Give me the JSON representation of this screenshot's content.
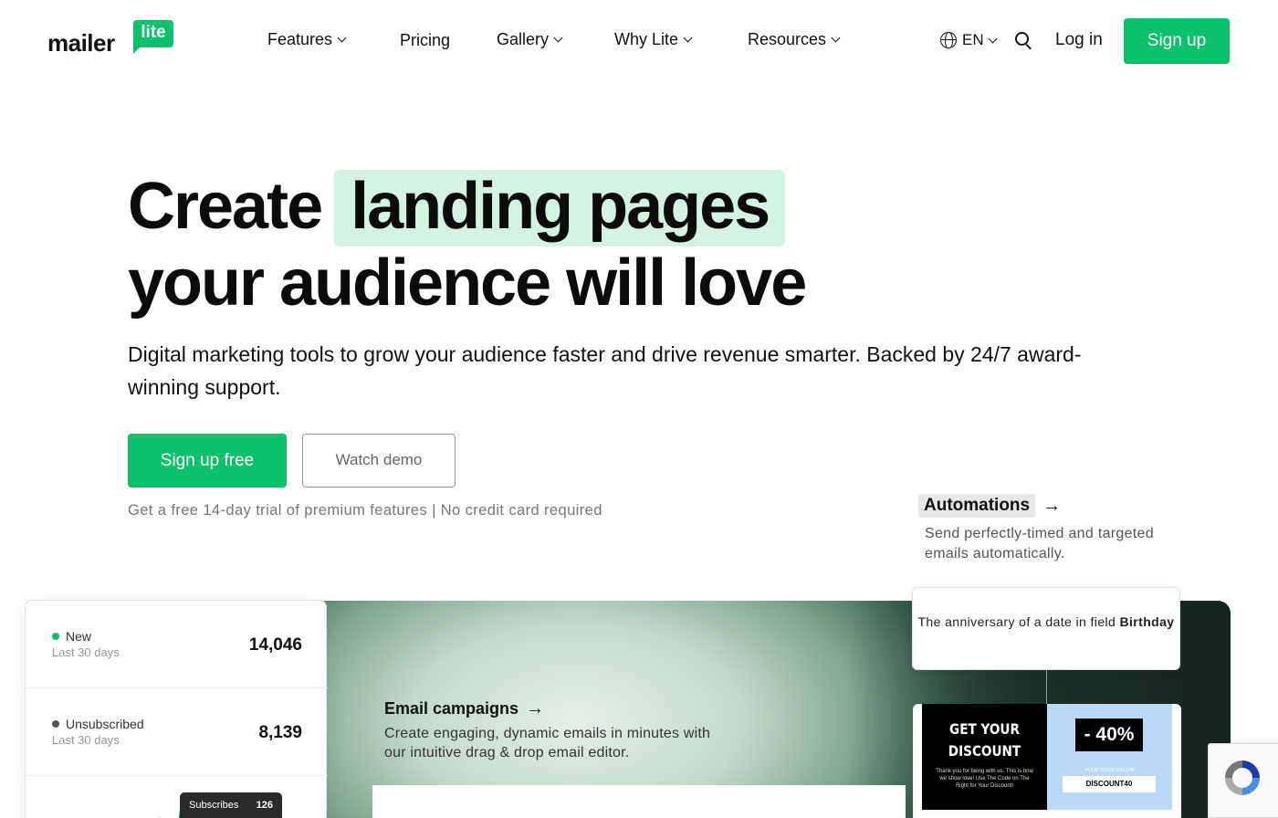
{
  "brand": {
    "logo_word": "mailer",
    "logo_bubble": "lite",
    "accent_color": "#09c269"
  },
  "nav": {
    "items": [
      {
        "label": "Features",
        "has_dropdown": true
      },
      {
        "label": "Pricing",
        "has_dropdown": false
      },
      {
        "label": "Gallery",
        "has_dropdown": true
      },
      {
        "label": "Why Lite",
        "has_dropdown": true
      },
      {
        "label": "Resources",
        "has_dropdown": true
      }
    ],
    "language": "EN",
    "login": "Log in",
    "signup": "Sign up"
  },
  "hero": {
    "title_line1_prefix": "Create",
    "title_highlight": "landing pages",
    "title_line2": "your audience will love",
    "subtitle": "Digital marketing tools to grow your audience faster and drive revenue smarter. Backed by 24/7 award-winning support.",
    "cta_primary": "Sign up free",
    "cta_secondary": "Watch demo",
    "trial_note": "Get a free 14-day trial of premium features | No credit card required"
  },
  "automations": {
    "title": "Automations",
    "description": "Send perfectly-timed and targeted emails automatically."
  },
  "stats": {
    "items": [
      {
        "name": "New",
        "period": "Last 30 days",
        "value": "14,046",
        "dot_color": "#09c269"
      },
      {
        "name": "Unsubscribed",
        "period": "Last 30 days",
        "value": "8,139",
        "dot_color": "#555555"
      }
    ],
    "tooltip": {
      "label": "Subscribes",
      "value": "126"
    }
  },
  "email_campaigns": {
    "title": "Email campaigns",
    "description": "Create engaging, dynamic emails in minutes with our intuitive drag & drop email editor."
  },
  "automation_card": {
    "text_prefix": "The anniversary of a date in field",
    "field": "Birthday"
  },
  "promo": {
    "headline": "GET YOUR DISCOUNT",
    "body": "Thank you for being with us. This is how we show love! Use The Code on The Right for Your Discount!",
    "percent": "- 40%",
    "code_label": "YOUR CODE BELOW",
    "code": "DISCOUNT40"
  }
}
